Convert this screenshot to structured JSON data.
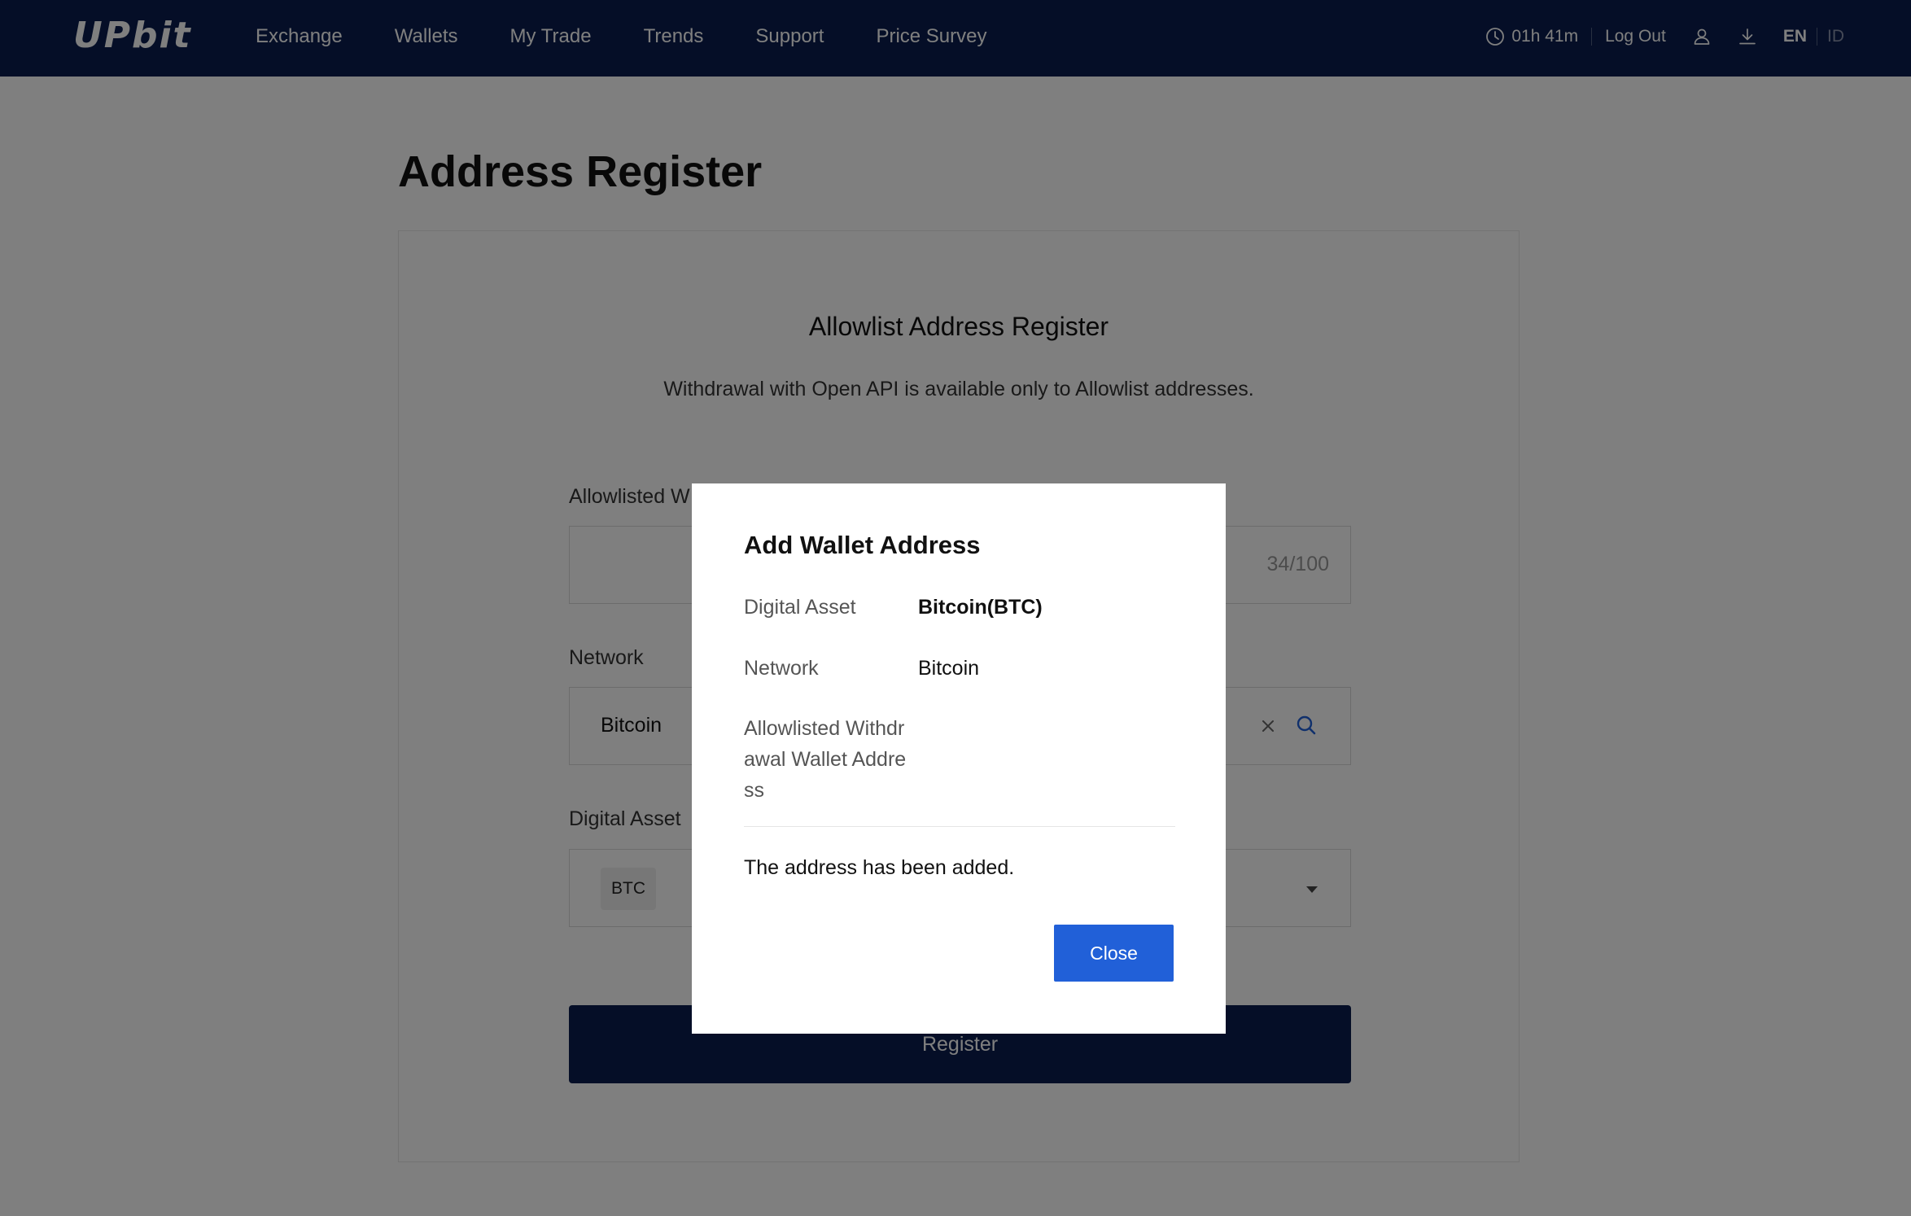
{
  "header": {
    "logo": "UPbit",
    "nav": [
      "Exchange",
      "Wallets",
      "My Trade",
      "Trends",
      "Support",
      "Price Survey"
    ],
    "timer": "01h 41m",
    "logout": "Log Out",
    "lang_en": "EN",
    "lang_id": "ID"
  },
  "page": {
    "title": "Address Register",
    "card_title": "Allowlist Address Register",
    "card_subtitle": "Withdrawal with Open API is available only to Allowlist addresses.",
    "address_label": "Allowlisted W",
    "address_counter": "34/100",
    "network_label": "Network",
    "network_value": "Bitcoin",
    "asset_label": "Digital Asset",
    "asset_chip": "BTC",
    "register_label": "Register"
  },
  "modal": {
    "title": "Add Wallet Address",
    "asset_label": "Digital Asset",
    "asset_value": "Bitcoin(BTC)",
    "network_label": "Network",
    "network_value": "Bitcoin",
    "address_label": "Allowlisted Withdrawal Wallet Address",
    "message": "The address has been added.",
    "close_label": "Close"
  },
  "colors": {
    "header_bg": "#0a1d4e",
    "primary_button": "#2160d8",
    "register_bg": "#0a1d4e",
    "overlay": "rgba(0,0,0,0.5)"
  }
}
